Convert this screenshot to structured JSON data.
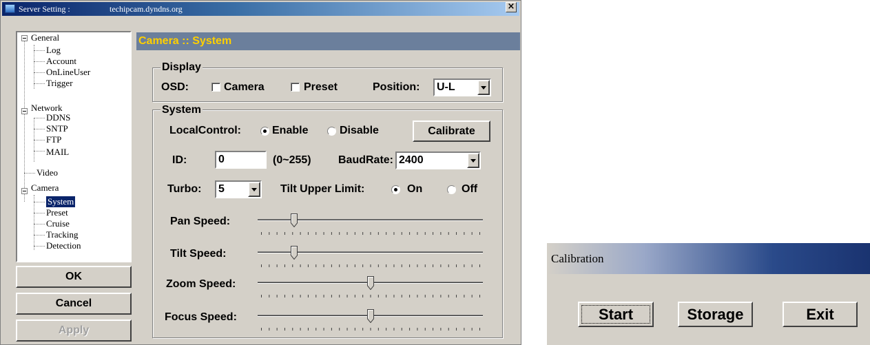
{
  "window": {
    "title": "Server Setting :",
    "host": "techipcam.dyndns.org",
    "close_label": "×"
  },
  "tree": {
    "general": "General",
    "log": "Log",
    "account": "Account",
    "onlineuser": "OnLineUser",
    "trigger": "Trigger",
    "network": "Network",
    "ddns": "DDNS",
    "sntp": "SNTP",
    "ftp": "FTP",
    "mail": "MAIL",
    "video": "Video",
    "camera": "Camera",
    "system": "System",
    "preset": "Preset",
    "cruise": "Cruise",
    "tracking": "Tracking",
    "detection": "Detection",
    "selected": "System"
  },
  "left_buttons": {
    "ok": "OK",
    "cancel": "Cancel",
    "apply": "Apply"
  },
  "panel": {
    "header": "Camera :: System"
  },
  "display": {
    "group_title": "Display",
    "osd_label": "OSD:",
    "camera_label": "Camera",
    "camera_checked": false,
    "preset_label": "Preset",
    "preset_checked": false,
    "position_label": "Position:",
    "position_value": "U-L"
  },
  "system": {
    "group_title": "System",
    "local_control_label": "LocalControl:",
    "enable_label": "Enable",
    "disable_label": "Disable",
    "local_control_value": "Enable",
    "calibrate_label": "Calibrate",
    "id_label": "ID:",
    "id_value": "0",
    "id_range": "(0~255)",
    "baudrate_label": "BaudRate:",
    "baudrate_value": "2400",
    "turbo_label": "Turbo:",
    "turbo_value": "5",
    "tilt_limit_label": "Tilt Upper Limit:",
    "on_label": "On",
    "off_label": "Off",
    "tilt_limit_value": "On",
    "sliders": [
      {
        "label": "Pan Speed:",
        "level": 0.15
      },
      {
        "label": "Tilt Speed:",
        "level": 0.15
      },
      {
        "label": "Zoom Speed:",
        "level": 0.5
      },
      {
        "label": "Focus Speed:",
        "level": 0.5
      }
    ]
  },
  "calibration": {
    "title": "Calibration",
    "start": "Start",
    "storage": "Storage",
    "exit": "Exit"
  }
}
